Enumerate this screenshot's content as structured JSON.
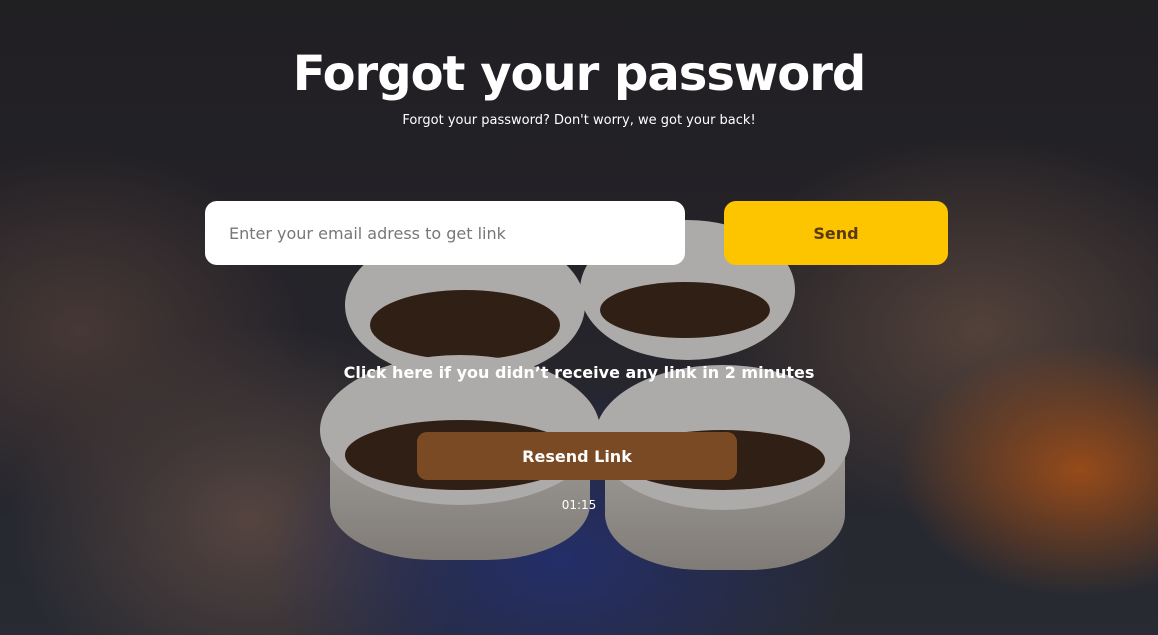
{
  "page": {
    "title": "Forgot your password",
    "subtitle": "Forgot your password? Don't worry, we got your back!"
  },
  "form": {
    "email_placeholder": "Enter your email adress to get link",
    "email_value": "",
    "send_label": "Send"
  },
  "resend": {
    "prompt": "Click here if you didn’t receive any link in 2 minutes",
    "button_label": "Resend Link",
    "timer": "01:15"
  },
  "colors": {
    "send_button": "#fcc500",
    "resend_button": "#7a4a25",
    "input_bg": "#ffffff",
    "text": "#ffffff"
  }
}
